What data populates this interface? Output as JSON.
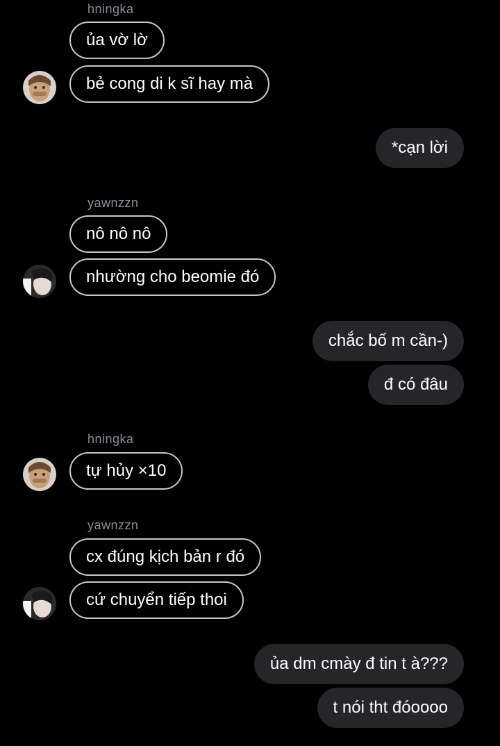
{
  "colors": {
    "background": "#000000",
    "incoming_border": "#c8c8c8",
    "outgoing_fill": "#262629",
    "username": "#8e8e93",
    "text": "#ffffff"
  },
  "messages": [
    {
      "sender": "hningka",
      "text": "ủa vờ lờ"
    },
    {
      "sender": "hningka",
      "text": "bẻ cong di k sĩ hay mà"
    },
    {
      "sender": "me",
      "text": "*cạn lời"
    },
    {
      "sender": "yawnzzn",
      "text": "nô nô nô"
    },
    {
      "sender": "yawnzzn",
      "text": "nhường cho beomie đó"
    },
    {
      "sender": "me",
      "text": "chắc bố m cần-)"
    },
    {
      "sender": "me",
      "text": "đ có đâu"
    },
    {
      "sender": "hningka",
      "text": "tự hủy ×10"
    },
    {
      "sender": "yawnzzn",
      "text": "cx đúng kịch bản r đó"
    },
    {
      "sender": "yawnzzn",
      "text": "cứ chuyển tiếp thoi"
    },
    {
      "sender": "me",
      "text": "ủa dm cmày đ tin t à???"
    },
    {
      "sender": "me",
      "text": "t nói tht đóoooo"
    }
  ],
  "usernames": {
    "first": "hningka",
    "second": "yawnzzn",
    "third": "hningka",
    "fourth": "yawnzzn"
  },
  "avatars": {
    "hningka": "avatar-hningka",
    "yawnzzn": "avatar-yawnzzn"
  }
}
